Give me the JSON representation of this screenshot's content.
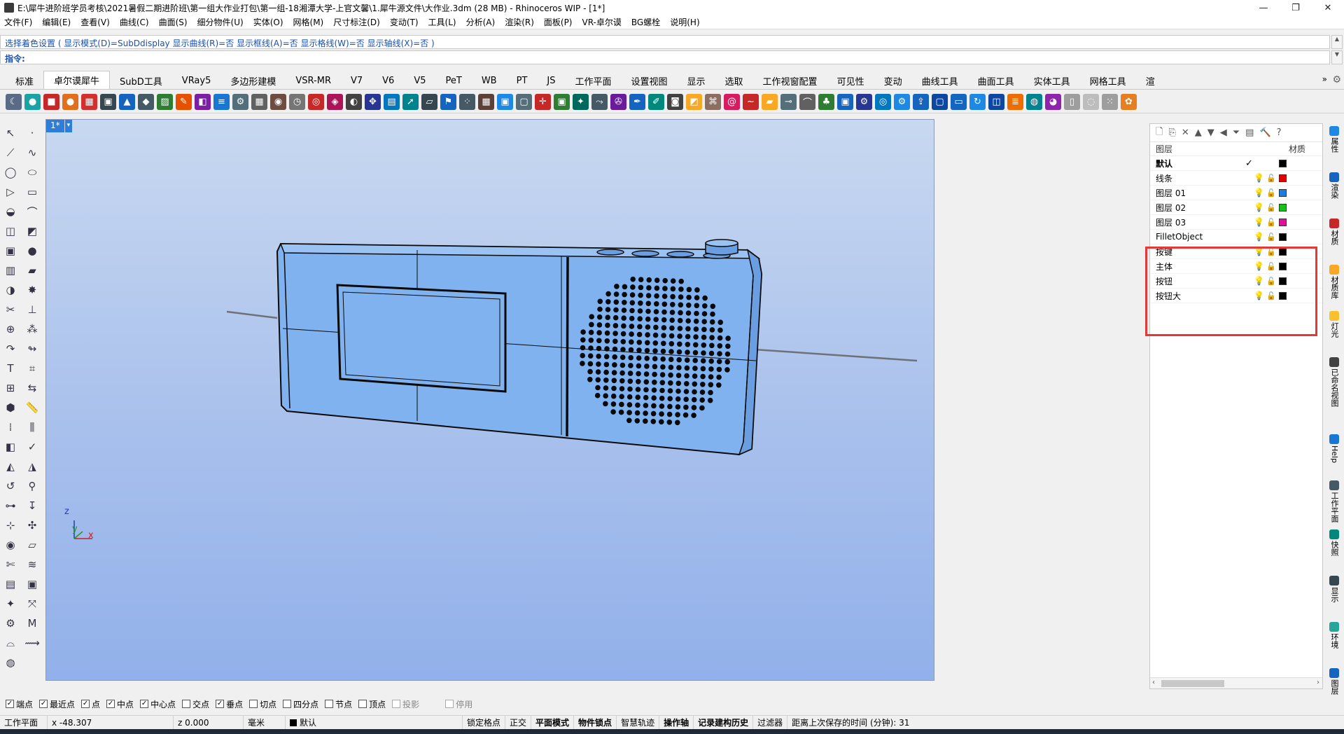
{
  "window": {
    "title": "E:\\犀牛进阶班学员考核\\2021暑假二期进阶班\\第一组大作业打包\\第一组-18湘潭大学-上官文馨\\1.犀牛源文件\\大作业.3dm (28 MB) - Rhinoceros WIP - [1*]",
    "minimize": "—",
    "maximize": "❐",
    "close": "✕"
  },
  "menu": [
    "文件(F)",
    "编辑(E)",
    "查看(V)",
    "曲线(C)",
    "曲面(S)",
    "细分物件(U)",
    "实体(O)",
    "网格(M)",
    "尺寸标注(D)",
    "变动(T)",
    "工具(L)",
    "分析(A)",
    "渲染(R)",
    "面板(P)",
    "VR-卓尔谟",
    "BG螺栓",
    "说明(H)"
  ],
  "command": {
    "history": "选择着色设置 ( 显示模式(D)=SubDdisplay  显示曲线(R)=否  显示框线(A)=否  显示格线(W)=否  显示轴线(X)=否 )",
    "prompt": "指令:",
    "scroll_up": "▲",
    "scroll_down": "▼"
  },
  "tabs": [
    "标准",
    "卓尔谟犀牛",
    "SubD工具",
    "VRay5",
    "多边形建模",
    "VSR-MR",
    "V7",
    "V6",
    "V5",
    "PeT",
    "WB",
    "PT",
    "JS",
    "工作平面",
    "设置视图",
    "显示",
    "选取",
    "工作视窗配置",
    "可见性",
    "变动",
    "曲线工具",
    "曲面工具",
    "实体工具",
    "网格工具",
    "渲"
  ],
  "tabs_active_index": 1,
  "tabs_more": "»",
  "tabs_gear": "⚙",
  "toolbar_icons": [
    {
      "name": "moon-icon",
      "glyph": "☾",
      "color": "#5a6b86"
    },
    {
      "name": "sphere-icon",
      "glyph": "●",
      "color": "#1aa3a3"
    },
    {
      "name": "box-icon",
      "glyph": "■",
      "color": "#c62828"
    },
    {
      "name": "ball-icon",
      "glyph": "●",
      "color": "#e0701c"
    },
    {
      "name": "checker-icon",
      "glyph": "▦",
      "color": "#d32f2f"
    },
    {
      "name": "cube-icon",
      "glyph": "▣",
      "color": "#37474f"
    },
    {
      "name": "car-icon",
      "glyph": "▲",
      "color": "#1565c0"
    },
    {
      "name": "diamond-icon",
      "glyph": "◆",
      "color": "#455a64"
    },
    {
      "name": "image-icon",
      "glyph": "▨",
      "color": "#2e7d32"
    },
    {
      "name": "tool-icon",
      "glyph": "✎",
      "color": "#e65100"
    },
    {
      "name": "gradient-icon",
      "glyph": "◧",
      "color": "#7b1fa2"
    },
    {
      "name": "layers-icon",
      "glyph": "≡",
      "color": "#1976d2"
    },
    {
      "name": "gear-icon",
      "glyph": "⚙",
      "color": "#546e7a"
    },
    {
      "name": "grid-icon",
      "glyph": "▦",
      "color": "#616161"
    },
    {
      "name": "cam-icon",
      "glyph": "◉",
      "color": "#6d4c41"
    },
    {
      "name": "clock-icon",
      "glyph": "◷",
      "color": "#757575"
    },
    {
      "name": "target-icon",
      "glyph": "◎",
      "color": "#c62828"
    },
    {
      "name": "pin-icon",
      "glyph": "◈",
      "color": "#ad1457"
    },
    {
      "name": "eye-icon",
      "glyph": "◐",
      "color": "#424242"
    },
    {
      "name": "move-icon",
      "glyph": "✥",
      "color": "#283593"
    },
    {
      "name": "cylinder-icon",
      "glyph": "▤",
      "color": "#0277bd"
    },
    {
      "name": "arrow-icon",
      "glyph": "➚",
      "color": "#00838f"
    },
    {
      "name": "plane-icon",
      "glyph": "▱",
      "color": "#37474f"
    },
    {
      "name": "flag-icon",
      "glyph": "⚑",
      "color": "#1565c0"
    },
    {
      "name": "dots-icon",
      "glyph": "⁘",
      "color": "#455a64"
    },
    {
      "name": "mesh-icon",
      "glyph": "▦",
      "color": "#5d4037"
    },
    {
      "name": "box3d-icon",
      "glyph": "▣",
      "color": "#1e88e5"
    },
    {
      "name": "rect-icon",
      "glyph": "▢",
      "color": "#546e7a"
    },
    {
      "name": "cross-icon",
      "glyph": "✛",
      "color": "#c62828"
    },
    {
      "name": "frame-icon",
      "glyph": "▣",
      "color": "#2e7d32"
    },
    {
      "name": "lamp-icon",
      "glyph": "✦",
      "color": "#00695c"
    },
    {
      "name": "flow-icon",
      "glyph": "⤳",
      "color": "#455a64"
    },
    {
      "name": "wrench-icon",
      "glyph": "✇",
      "color": "#6a1b9a"
    },
    {
      "name": "pen-icon",
      "glyph": "✒",
      "color": "#1565c0"
    },
    {
      "name": "brush-icon",
      "glyph": "✐",
      "color": "#00897b"
    },
    {
      "name": "camera-icon",
      "glyph": "◙",
      "color": "#424242"
    },
    {
      "name": "contrast-icon",
      "glyph": "◩",
      "color": "#f9a825"
    },
    {
      "name": "mapping-icon",
      "glyph": "⌘",
      "color": "#8d6e63"
    },
    {
      "name": "spiral-icon",
      "glyph": "@",
      "color": "#d81b60"
    },
    {
      "name": "wave-icon",
      "glyph": "~",
      "color": "#c62828"
    },
    {
      "name": "folder-icon",
      "glyph": "▰",
      "color": "#f9a825"
    },
    {
      "name": "node-icon",
      "glyph": "⊸",
      "color": "#546e7a"
    },
    {
      "name": "arc-icon",
      "glyph": "⌒",
      "color": "#616161"
    },
    {
      "name": "tree-icon",
      "glyph": "♣",
      "color": "#2e7d32"
    },
    {
      "name": "cube-blue-icon",
      "glyph": "▣",
      "color": "#1565c0"
    },
    {
      "name": "settings-icon",
      "glyph": "⚙",
      "color": "#283593"
    },
    {
      "name": "circle-settings-icon",
      "glyph": "◎",
      "color": "#0277bd"
    },
    {
      "name": "circle-gear-icon",
      "glyph": "⚙",
      "color": "#1e88e5"
    },
    {
      "name": "export-icon",
      "glyph": "⇪",
      "color": "#1565c0"
    },
    {
      "name": "square-icon",
      "glyph": "▢",
      "color": "#0d47a1"
    },
    {
      "name": "window-icon",
      "glyph": "▭",
      "color": "#1565c0"
    },
    {
      "name": "refresh-icon",
      "glyph": "↻",
      "color": "#1e88e5"
    },
    {
      "name": "camera-view-icon",
      "glyph": "◫",
      "color": "#0d47a1"
    },
    {
      "name": "stack-icon",
      "glyph": "≣",
      "color": "#ef6c00"
    },
    {
      "name": "globe-icon",
      "glyph": "◍",
      "color": "#00838f"
    },
    {
      "name": "pie-icon",
      "glyph": "◕",
      "color": "#8e24aa"
    },
    {
      "name": "paper-icon",
      "glyph": "▯",
      "color": "#9e9e9e"
    },
    {
      "name": "ball-mesh-icon",
      "glyph": "◌",
      "color": "#bdbdbd"
    },
    {
      "name": "dotgrid-icon",
      "glyph": "⁙",
      "color": "#9e9e9e"
    },
    {
      "name": "leaf-icon",
      "glyph": "✿",
      "color": "#e67e22"
    }
  ],
  "left_tools": [
    {
      "name": "select-arrow-icon",
      "glyph": "↖"
    },
    {
      "name": "point-icon",
      "glyph": "·"
    },
    {
      "name": "polyline-icon",
      "glyph": "⟋"
    },
    {
      "name": "curve-icon",
      "glyph": "∿"
    },
    {
      "name": "circle-icon",
      "glyph": "◯"
    },
    {
      "name": "ellipse-icon",
      "glyph": "⬭"
    },
    {
      "name": "polygon-icon",
      "glyph": "▷"
    },
    {
      "name": "rectangle-icon",
      "glyph": "▭"
    },
    {
      "name": "arc-tool-icon",
      "glyph": "◒"
    },
    {
      "name": "fillet-icon",
      "glyph": "⌒"
    },
    {
      "name": "surface-icon",
      "glyph": "◫"
    },
    {
      "name": "loft-icon",
      "glyph": "◩"
    },
    {
      "name": "box-solid-icon",
      "glyph": "▣"
    },
    {
      "name": "sphere-solid-icon",
      "glyph": "●"
    },
    {
      "name": "cylinder-solid-icon",
      "glyph": "▥"
    },
    {
      "name": "extrude-icon",
      "glyph": "▰"
    },
    {
      "name": "boolean-icon",
      "glyph": "◑"
    },
    {
      "name": "explode-icon",
      "glyph": "✸"
    },
    {
      "name": "trim-icon",
      "glyph": "✂"
    },
    {
      "name": "split-icon",
      "glyph": "⊥"
    },
    {
      "name": "join-icon",
      "glyph": "⊕"
    },
    {
      "name": "group-icon",
      "glyph": "⁂"
    },
    {
      "name": "offset-icon",
      "glyph": "↷"
    },
    {
      "name": "blend-icon",
      "glyph": "↬"
    },
    {
      "name": "text-icon",
      "glyph": "T"
    },
    {
      "name": "dimension-icon",
      "glyph": "⌗"
    },
    {
      "name": "array-icon",
      "glyph": "⊞"
    },
    {
      "name": "mirror-icon",
      "glyph": "⇆"
    },
    {
      "name": "shell-icon",
      "glyph": "⬢"
    },
    {
      "name": "ruler-icon",
      "glyph": "📏"
    },
    {
      "name": "matrix-icon",
      "glyph": "⁞"
    },
    {
      "name": "pipe-icon",
      "glyph": "⫼"
    },
    {
      "name": "cut-icon",
      "glyph": "◧"
    },
    {
      "name": "check-icon",
      "glyph": "✓"
    },
    {
      "name": "cap-icon",
      "glyph": "◭"
    },
    {
      "name": "paint-icon",
      "glyph": "◮"
    },
    {
      "name": "twist-icon",
      "glyph": "↺"
    },
    {
      "name": "lamp-tool-icon",
      "glyph": "⚲"
    },
    {
      "name": "connect-icon",
      "glyph": "⊶"
    },
    {
      "name": "pin-tool-icon",
      "glyph": "↧"
    },
    {
      "name": "align-icon",
      "glyph": "⊹"
    },
    {
      "name": "distribute-icon",
      "glyph": "✣"
    },
    {
      "name": "globe-tool-icon",
      "glyph": "◉"
    },
    {
      "name": "sheet-icon",
      "glyph": "▱"
    },
    {
      "name": "scissors-icon",
      "glyph": "✄"
    },
    {
      "name": "spring-icon",
      "glyph": "≋"
    },
    {
      "name": "zebra-icon",
      "glyph": "▤"
    },
    {
      "name": "save-icon",
      "glyph": "▣"
    },
    {
      "name": "vray-icon",
      "glyph": "✦"
    },
    {
      "name": "node-tool-icon",
      "glyph": "⤧"
    },
    {
      "name": "gear-tool-icon",
      "glyph": "⚙"
    },
    {
      "name": "m-logo-icon",
      "glyph": "M"
    },
    {
      "name": "curvature-icon",
      "glyph": "⌓"
    },
    {
      "name": "sweep-icon",
      "glyph": "⟿"
    },
    {
      "name": "earth-icon",
      "glyph": "◍"
    }
  ],
  "viewport": {
    "tab_name": "1*",
    "tab_arrow": "▾",
    "axis_x": "x",
    "axis_y": "y",
    "axis_z": "z"
  },
  "layers_panel": {
    "toolbar": [
      "🗋",
      "⎘",
      "✕",
      "▲",
      "▼",
      "◀",
      "⏷",
      "▤",
      "🔨",
      "?"
    ],
    "header_layer": "图层",
    "header_material": "材质",
    "rows": [
      {
        "name": "默认",
        "current": true,
        "check": "✓",
        "color": "#000000"
      },
      {
        "name": "线条",
        "color": "#e00000"
      },
      {
        "name": "图层 01",
        "color": "#1a7fe0"
      },
      {
        "name": "图层 02",
        "color": "#18c018"
      },
      {
        "name": "图层 03",
        "color": "#e0109a"
      },
      {
        "name": "FilletObject",
        "color": "#000000"
      },
      {
        "name": "按键",
        "color": "#000000"
      },
      {
        "name": "主体",
        "color": "#000000"
      },
      {
        "name": "按钮",
        "color": "#000000"
      },
      {
        "name": "按钮大",
        "color": "#000000"
      }
    ],
    "bulb_glyph": "💡",
    "lock_glyph": "🔓",
    "highlight_color": "#e53935"
  },
  "right_sidebar": [
    {
      "name": "properties-icon",
      "label": "属性",
      "color": "#1e88e5"
    },
    {
      "name": "render-icon",
      "label": "渲染",
      "color": "#1565c0"
    },
    {
      "name": "material-icon",
      "label": "材质",
      "color": "#c62828"
    },
    {
      "name": "material-library-icon",
      "label": "材质库",
      "color": "#f9a825"
    },
    {
      "name": "light-icon",
      "label": "灯光",
      "color": "#fbc02d"
    },
    {
      "name": "named-view-icon",
      "label": "已命名视图",
      "color": "#424242"
    },
    {
      "name": "help-icon",
      "label": "Help",
      "color": "#1976d2"
    },
    {
      "name": "construction-plane-icon",
      "label": "工作平面",
      "color": "#455a64"
    },
    {
      "name": "snapshot-icon",
      "label": "快照",
      "color": "#00897b"
    },
    {
      "name": "display-icon",
      "label": "显示",
      "color": "#37474f"
    },
    {
      "name": "environment-icon",
      "label": "环境",
      "color": "#26a69a"
    },
    {
      "name": "layer-tab-icon",
      "label": "图层",
      "color": "#1565c0"
    }
  ],
  "osnap": [
    {
      "label": "端点",
      "checked": true
    },
    {
      "label": "最近点",
      "checked": true
    },
    {
      "label": "点",
      "checked": true
    },
    {
      "label": "中点",
      "checked": true
    },
    {
      "label": "中心点",
      "checked": true
    },
    {
      "label": "交点",
      "checked": false
    },
    {
      "label": "垂点",
      "checked": true
    },
    {
      "label": "切点",
      "checked": false
    },
    {
      "label": "四分点",
      "checked": false
    },
    {
      "label": "节点",
      "checked": false
    },
    {
      "label": "顶点",
      "checked": false
    },
    {
      "label": "投影",
      "checked": false,
      "dim": true
    },
    {
      "label": "停用",
      "checked": false,
      "dim": true
    }
  ],
  "status": {
    "cplane": "工作平面",
    "x": "x -48.307",
    "z": "z 0.000",
    "unit": "毫米",
    "layer": "默认",
    "grid_snap": "锁定格点",
    "ortho": "正交",
    "planar": "平面模式",
    "osnap": "物件锁点",
    "smarttrack": "智慧轨迹",
    "gumball": "操作轴",
    "history": "记录建构历史",
    "filter": "过滤器",
    "autosave": "距离上次保存的时间 (分钟): 31"
  }
}
